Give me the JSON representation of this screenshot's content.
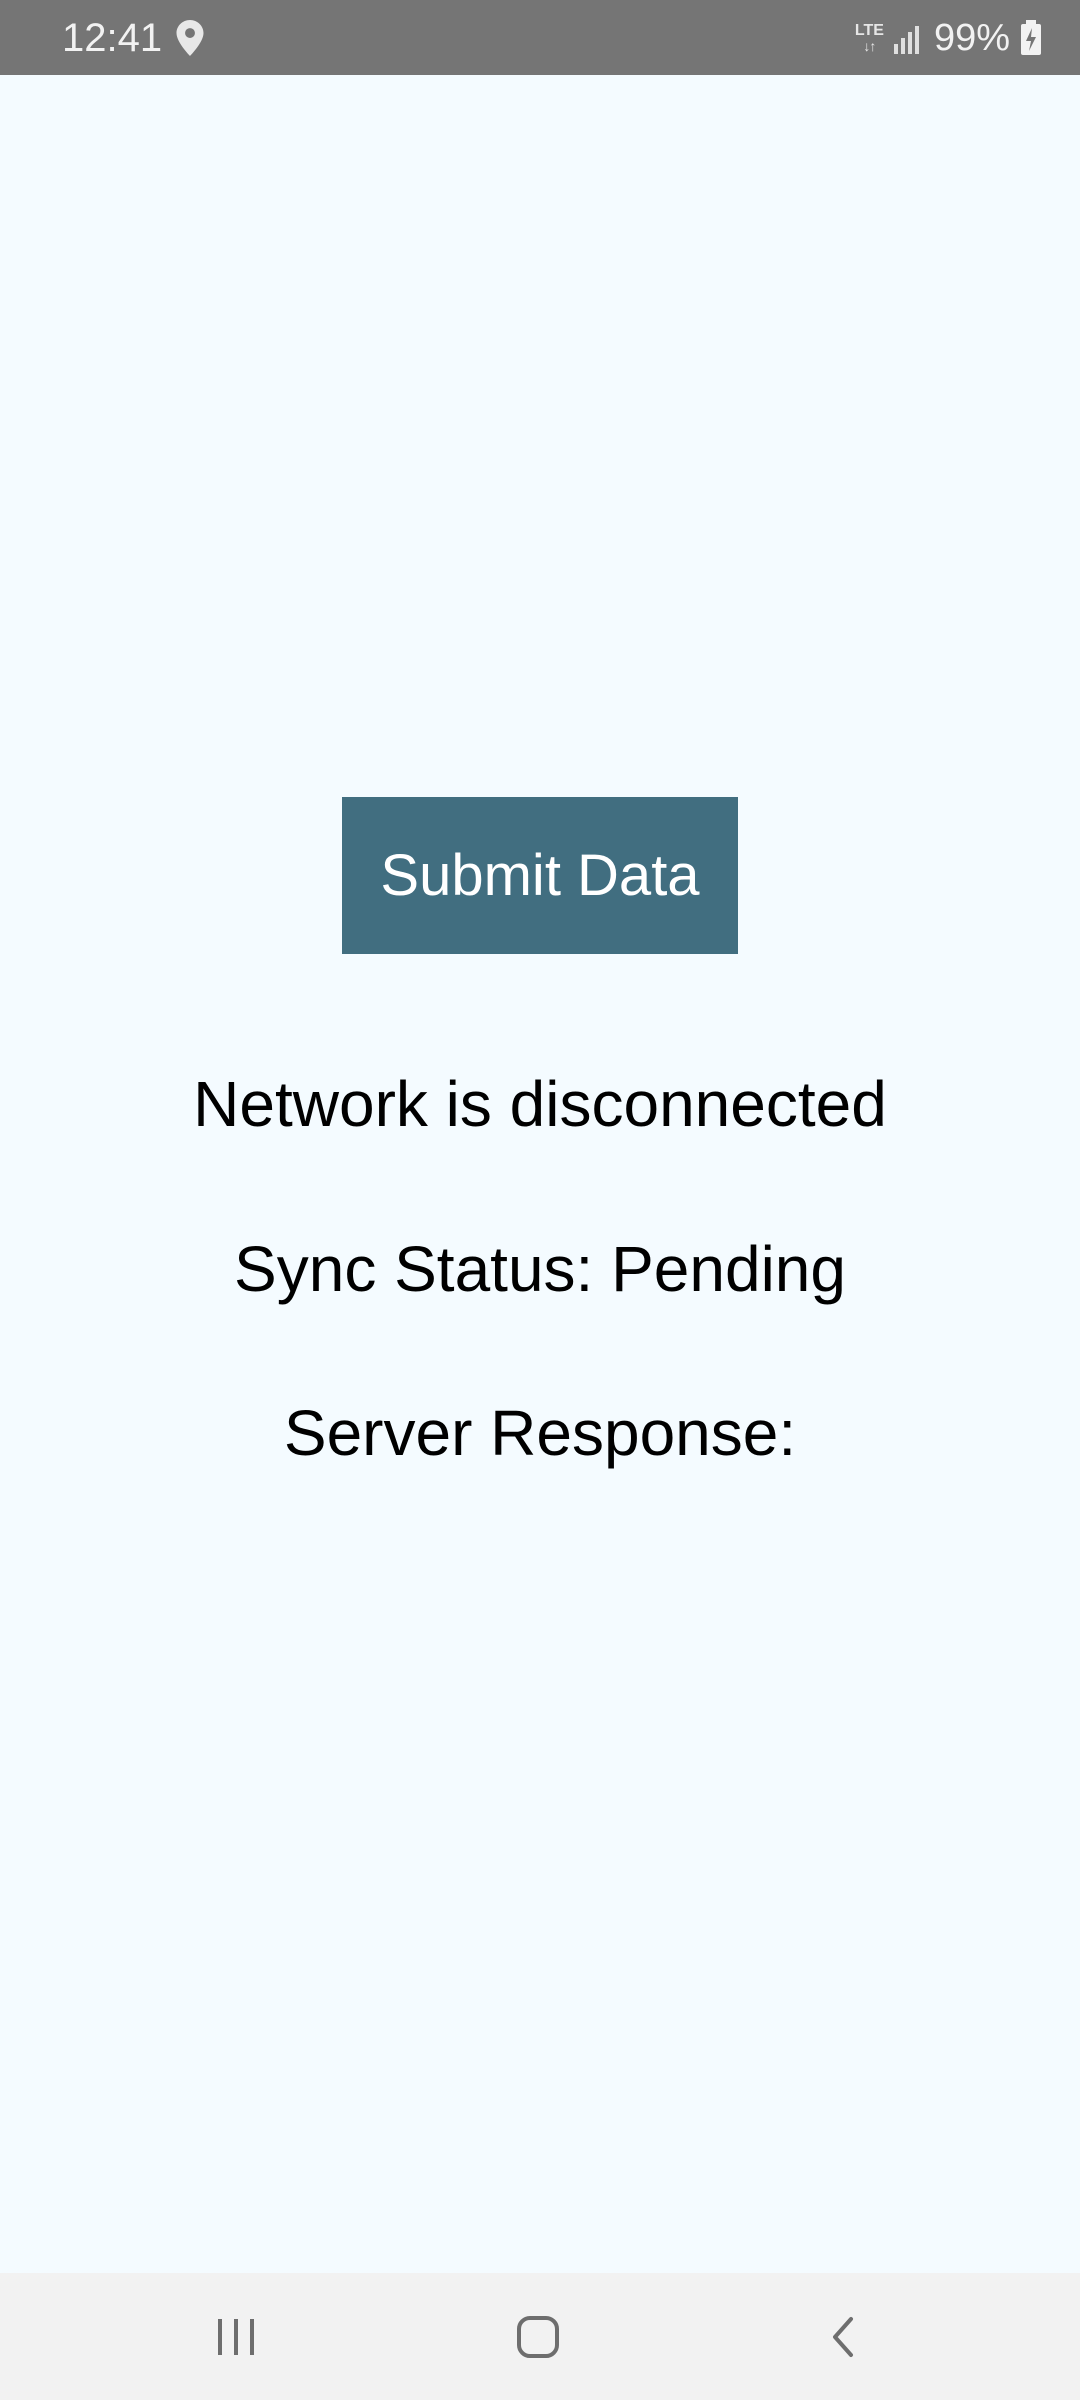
{
  "status_bar": {
    "time": "12:41",
    "location_icon": "location-pin-icon",
    "network_type": "LTE",
    "network_arrows": "↓↑",
    "signal_icon": "signal-bars-icon",
    "battery_percent": "99%",
    "battery_icon": "battery-charging-icon"
  },
  "main": {
    "submit_button_label": "Submit Data",
    "network_status": "Network is disconnected",
    "sync_status": "Sync Status: Pending",
    "server_response": "Server Response:"
  },
  "nav_bar": {
    "recents_icon": "recents-icon",
    "home_icon": "home-icon",
    "back_icon": "back-icon"
  },
  "colors": {
    "background": "#f4fbff",
    "button": "#416e80",
    "status_bar": "#757575",
    "nav_bar": "#f2f2f2"
  }
}
